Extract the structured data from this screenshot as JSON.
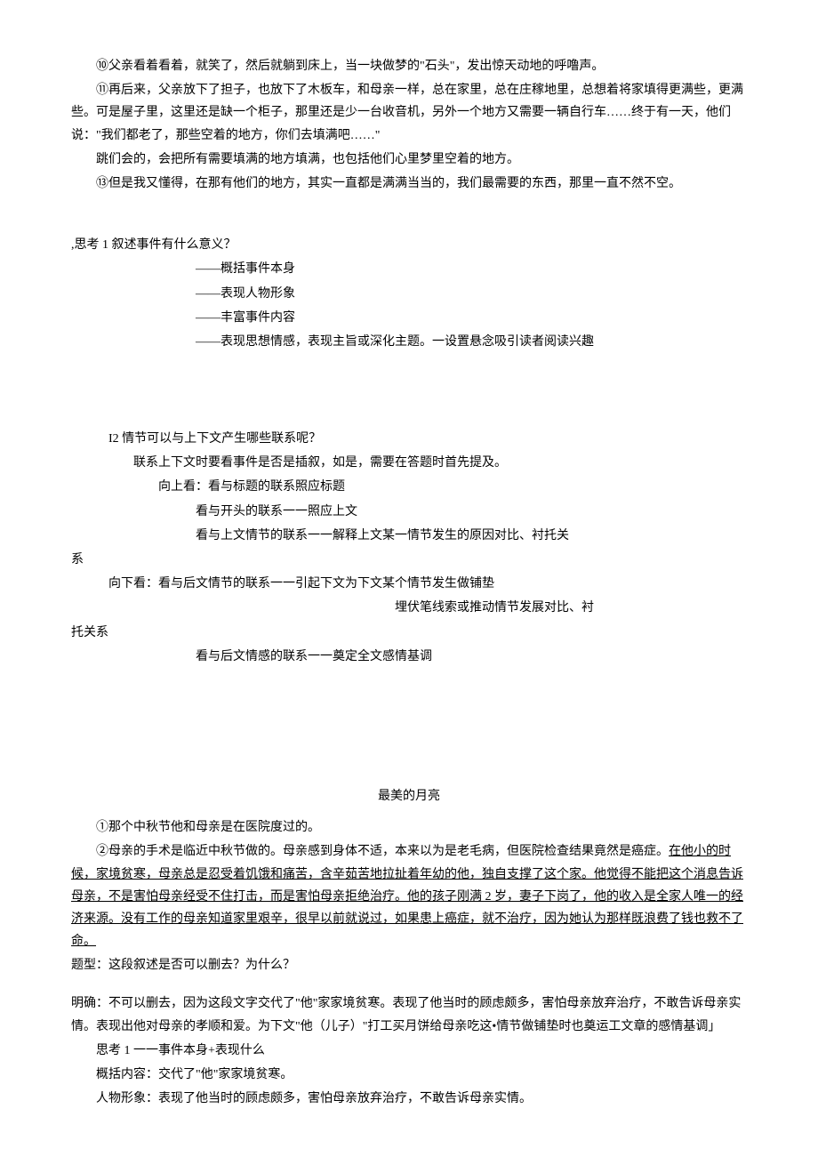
{
  "top": {
    "p1": "⑩父亲看着看着，就笑了，然后就躺到床上，当一块做梦的\"石头\"，发出惊天动地的呼噜声。",
    "p2": "⑪再后来，父亲放下了担子，也放下了木板车，和母亲一样，总在家里，总在庄稼地里，总想着将家填得更满些，更满些。可是屋子里，这里还是缺一个柜子，那里还是少一台收音机，另外一个地方又需要一辆自行车……终于有一天，他们说：\"我们都老了，那些空着的地方，你们去填满吧……\"",
    "p3": "跳们会的，会把所有需要填满的地方填满，也包括他们心里梦里空着的地方。",
    "p4": "⑬但是我又懂得，在那有他们的地方，其实一直都是满满当当的，我们最需要的东西，那里一直不然不空。"
  },
  "think1": {
    "title": ",思考 1 叙述事件有什么意义？",
    "l1": "——概括事件本身",
    "l2": "——表现人物形象",
    "l3": "——丰富事件内容",
    "l4": "——表现思想情感，表现主旨或深化主题。一设置悬念吸引读者阅读兴趣"
  },
  "think2": {
    "title": "I2 情节可以与上下文产生哪些联系呢？",
    "l1": "联系上下文时要看事件是否是插叙，如是，需要在答题时首先提及。",
    "l2": "向上看：看与标题的联系照应标题",
    "l3": "看与开头的联系一一照应上文",
    "l4": "看与上文情节的联系一一解释上文某一情节发生的原因对比、衬托关",
    "l4b": "系",
    "l5": "向下看：看与后文情节的联系一一引起下文为下文某个情节发生做铺垫",
    "l6": "埋伏笔线索或推动情节发展对比、衬",
    "l6b": "托关系",
    "l7": "看与后文情感的联系一一奠定全文感情基调"
  },
  "moon": {
    "title": "最美的月亮",
    "p1": "①那个中秋节他和母亲是在医院度过的。",
    "p2a": "②母亲的手术是临近中秋节做的。母亲感到身体不适，本来以为是老毛病，但医院检查结果竟然是癌症。",
    "p2b": "在他小的时候，家境贫寒，母亲总是忍受着饥饿和痛苦，含辛茹苦地拉扯着年幼的他，独自支撑了这个家。他觉得不能把这个消息告诉母亲，不是害怕母亲经受不住打击，而是害怕母亲拒绝治疗。他的孩子刚满 2 岁，妻子下岗了，他的收入是全家人唯一的经济来源。没有工作的母亲知道家里艰辛，很早以前就说过，如果患上癌症，就不治疗，因为她认为那样既浪费了钱也救不了命。",
    "q": "题型：这段叙述是否可以删去？为什么？",
    "a": "明确：不可以删去，因为这段文字交代了\"他\"家家境贫寒。表现了他当时的顾虑颇多，害怕母亲放弃治疗，不敢告诉母亲实情。表现出他对母亲的孝顺和爱。为下文\"他（儿子）\"打工买月饼给母亲吃这•情节做铺垫时也奠运工文章的感情基调」",
    "s1": "思考 1 一一事件本身+表现什么",
    "s2": "概括内容：交代了\"他\"家家境贫寒。",
    "s3": "人物形象：表现了他当时的顾虑颇多，害怕母亲放弃治疗，不敢告诉母亲实情。"
  }
}
